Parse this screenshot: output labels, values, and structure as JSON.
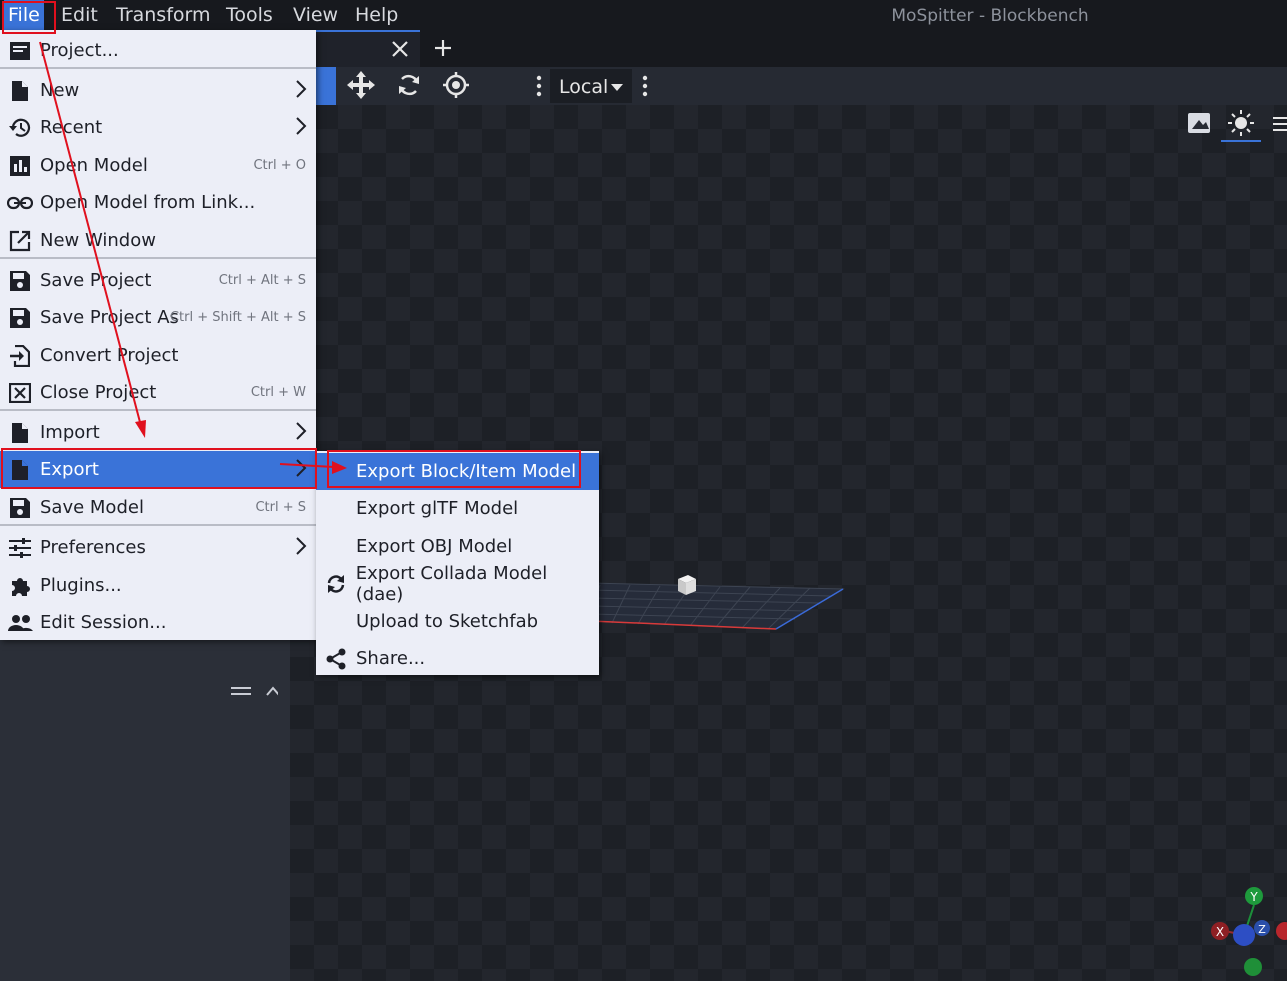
{
  "window": {
    "title": "MoSpitter - Blockbench"
  },
  "menubar": {
    "items": [
      {
        "label": "File",
        "active": true
      },
      {
        "label": "Edit"
      },
      {
        "label": "Transform"
      },
      {
        "label": "Tools"
      },
      {
        "label": "View"
      },
      {
        "label": "Help"
      }
    ]
  },
  "toolbar": {
    "transform_space": "Local",
    "icons": [
      "move-icon",
      "rotate-icon",
      "pivot-icon"
    ]
  },
  "file_menu": {
    "items": [
      {
        "label": "Project...",
        "icon": "project-icon"
      },
      {
        "label": "New",
        "icon": "file-icon",
        "submenu": true
      },
      {
        "label": "Recent",
        "icon": "history-icon",
        "submenu": true
      },
      {
        "label": "Open Model",
        "icon": "chart-icon",
        "shortcut": "Ctrl + O"
      },
      {
        "label": "Open Model from Link...",
        "icon": "link-icon"
      },
      {
        "label": "New Window",
        "icon": "open-in-new-icon"
      },
      {
        "label": "Save Project",
        "icon": "save-icon",
        "shortcut": "Ctrl + Alt + S"
      },
      {
        "label": "Save Project As",
        "icon": "save-icon",
        "shortcut": "Ctrl + Shift + Alt + S"
      },
      {
        "label": "Convert Project",
        "icon": "convert-icon"
      },
      {
        "label": "Close Project",
        "icon": "close-box-icon",
        "shortcut": "Ctrl + W"
      },
      {
        "label": "Import",
        "icon": "file-icon",
        "submenu": true
      },
      {
        "label": "Export",
        "icon": "file-icon",
        "submenu": true,
        "highlighted": true
      },
      {
        "label": "Save Model",
        "icon": "save-icon",
        "shortcut": "Ctrl + S"
      },
      {
        "label": "Preferences",
        "icon": "tune-icon",
        "submenu": true
      },
      {
        "label": "Plugins...",
        "icon": "puzzle-icon"
      },
      {
        "label": "Edit Session...",
        "icon": "people-icon"
      }
    ]
  },
  "export_menu": {
    "items": [
      {
        "label": "Export Block/Item Model",
        "highlighted": true
      },
      {
        "label": "Export glTF Model"
      },
      {
        "label": "Export OBJ Model"
      },
      {
        "label": "Export Collada Model (dae)",
        "icon": "sync-icon"
      },
      {
        "label": "Upload to Sketchfab"
      },
      {
        "label": "Share...",
        "icon": "share-icon"
      }
    ]
  },
  "axis_gizmo": {
    "y": "Y",
    "x": "X",
    "z": "Z"
  },
  "colors": {
    "accent": "#3a73d8",
    "annotation": "#e0101e",
    "menu_bg": "#eceef7"
  }
}
